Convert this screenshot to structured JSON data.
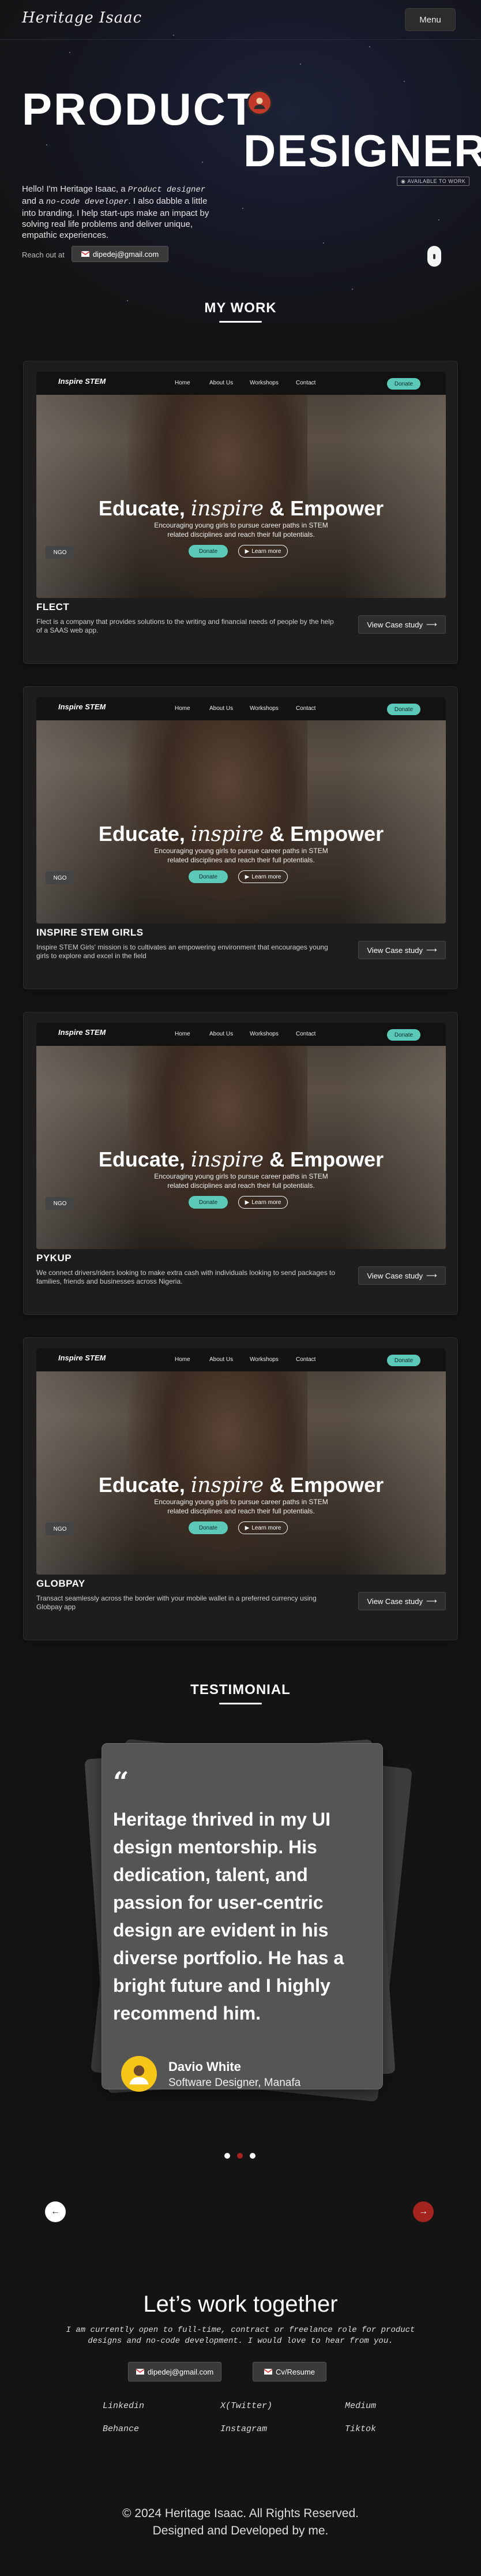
{
  "header": {
    "logo": "Heritage Isaac",
    "menu_label": "Menu"
  },
  "hero": {
    "title_line1": "PRODUCT",
    "title_line2": "DESIGNER",
    "available_badge": "AVAILABLE TO WORK",
    "bio_part1": "Hello! I'm Heritage Isaac, a ",
    "bio_role1": "Product designer",
    "bio_part2": " and a ",
    "bio_role2": "no-code developer",
    "bio_part3": ". I also dabble a little into branding. I help start-ups make an impact by solving real life problems and deliver unique, empathic experiences.",
    "reach_label": "Reach out at",
    "email": "dipedej@gmail.com"
  },
  "work": {
    "title": "MY WORK",
    "case_study_label": "View Case study",
    "preview": {
      "logo": "Inspire STEM",
      "nav": [
        "Home",
        "About Us",
        "Workshops",
        "Contact"
      ],
      "donate": "Donate",
      "headline_a": "Educate, ",
      "headline_b": "inspire",
      "headline_c": " & Empower",
      "subline": "Encouraging young girls to pursue career paths in STEM related disciplines and reach their full potentials.",
      "btn_donate": "Donate",
      "btn_learn": "Learn more",
      "ngo": "NGO"
    },
    "projects": [
      {
        "name": "FLECT",
        "desc": "Flect is a company that provides solutions to the writing and financial needs of people by the help of a SAAS web app."
      },
      {
        "name": "INSPIRE STEM GIRLS",
        "desc": "Inspire STEM Girls' mission is to cultivates an empowering environment that encourages young girls to explore and excel in the field"
      },
      {
        "name": "PYKUP",
        "desc": "We connect drivers/riders looking to make extra cash with individuals looking to send packages to families, friends and businesses across Nigeria."
      },
      {
        "name": "GLOBPAY",
        "desc": "Transact seamlessly across the border with your mobile wallet in a preferred currency using Globpay app"
      }
    ]
  },
  "testimonial": {
    "title": "TESTIMONIAL",
    "quote_mark": "“",
    "quote": "Heritage thrived in my UI design mentorship. His dedication, talent, and passion for user-centric design are evident in his diverse portfolio. He has a bright future and I highly recommend him.",
    "name": "Davio White",
    "role": "Software Designer, Manafa"
  },
  "cta": {
    "title": "Let’s work together",
    "subtitle": "I am currently open to full-time, contract or freelance role for product designs and no-code development. I would love to hear from you.",
    "email": "dipedej@gmail.com",
    "cv_label": "Cv/Resume",
    "socials": [
      "Linkedin",
      "X(Twitter)",
      "Medium",
      "Behance",
      "Instagram",
      "Tiktok"
    ]
  },
  "footer": {
    "line1": "© 2024 Heritage Isaac. All Rights Reserved.",
    "line2": "Designed and Developed by me."
  },
  "colors": {
    "accent_red": "#a3231f",
    "teal": "#5cc8b8",
    "background": "#141414"
  }
}
